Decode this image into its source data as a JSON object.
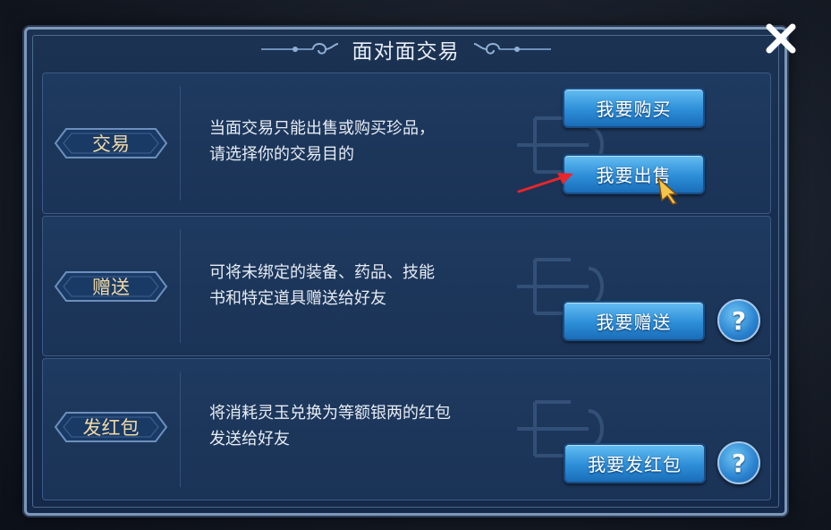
{
  "dialog": {
    "title": "面对面交易",
    "close_icon": "close-x-icon"
  },
  "sections": [
    {
      "label": "交易",
      "description_lines": [
        "当面交易只能出售或购买珍品，",
        "请选择你的交易目的"
      ],
      "buttons": [
        "我要购买",
        "我要出售"
      ],
      "has_help": false
    },
    {
      "label": "赠送",
      "description_lines": [
        "可将未绑定的装备、药品、技能",
        "书和特定道具赠送给好友"
      ],
      "buttons": [
        "我要赠送"
      ],
      "has_help": true,
      "help_symbol": "?"
    },
    {
      "label": "发红包",
      "description_lines": [
        "将消耗灵玉兑换为等额银两的红包",
        "发送给好友"
      ],
      "buttons": [
        "我要发红包"
      ],
      "has_help": true,
      "help_symbol": "?"
    }
  ],
  "overlay": {
    "arrow_icon": "red-arrow-icon",
    "cursor_icon": "golden-pointer-cursor-icon"
  },
  "colors": {
    "panel": "#1a3356",
    "label_text": "#f1d9a4",
    "button": "#2d8ed8",
    "arrow": "#e8262b"
  }
}
